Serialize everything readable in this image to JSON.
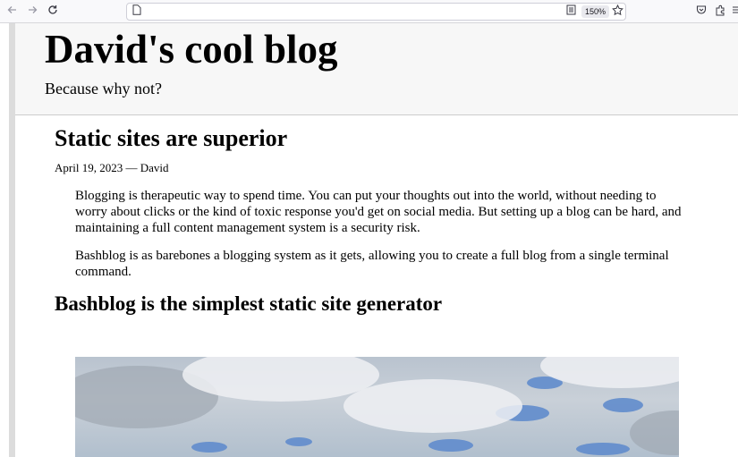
{
  "browser": {
    "zoom": "150%",
    "icons": {
      "back": "back-arrow-icon",
      "forward": "forward-arrow-icon",
      "reload": "reload-icon",
      "page": "page-icon",
      "reader": "reader-view-icon",
      "bookmark": "bookmark-star-icon",
      "pocket": "pocket-icon",
      "extensions": "extensions-icon",
      "menu": "menu-icon"
    }
  },
  "header": {
    "title": "David's cool blog",
    "tagline": "Because why not?"
  },
  "post": {
    "title": "Static sites are superior",
    "meta": "April 19, 2023 — David",
    "paragraphs": [
      "Blogging is therapeutic way to spend time. You can put your thoughts out into the world, without needing to worry about clicks or the kind of toxic response you'd get on social media. But setting up a blog can be hard, and maintaining a full content management system is a security risk.",
      "Bashblog is as barebones a blogging system as it gets, allowing you to create a full blog from a single terminal command."
    ],
    "subheading": "Bashblog is the simplest static site generator"
  },
  "colors": {
    "masthead_bg": "#f7f7f7",
    "text": "#000000",
    "toolbar_bg": "#f9f9fb"
  }
}
